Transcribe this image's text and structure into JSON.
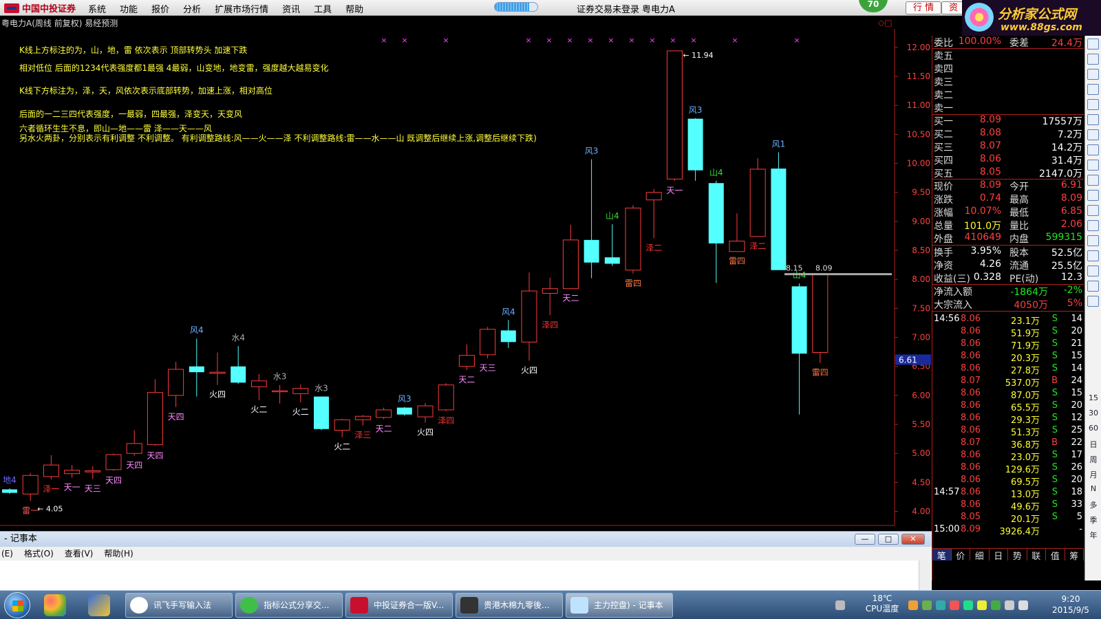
{
  "topbar": {
    "brand": "中国中投证券",
    "menu": [
      "系统",
      "功能",
      "报价",
      "分析",
      "扩展市场行情",
      "资讯",
      "工具",
      "帮助"
    ],
    "login_status": "证券交易未登录",
    "stock_name": "粤电力A",
    "badge": "70",
    "tab_quote": "行 情",
    "tab_trade": "资",
    "progress_fraction": 0.8,
    "logo_line1": "分析家公式网",
    "logo_line2": "www.88gs.com"
  },
  "chart": {
    "title": "粤电力A(周线 前复权) 易经预测",
    "notes": [
      "K线上方标注的为，山，地，雷 依次表示 顶部转势头  加速下跌",
      "相对低位 后面的1234代表强度都1最强 4最弱，山变地，地变雷，强度越大越易变化",
      "K线下方标注为，泽，天，风依次表示底部转势，加速上涨，相对高位",
      "后面的一二三四代表强度，一最弱，四最强，泽变天，天变风",
      "六者循环生生不息，即山—地——雷  泽——天——风",
      "另水火两卦，分别表示有利调整 不利调整。 有利调整路线:风——火——泽   不利调整路线:雷——水——山  既调整后继续上涨,调整后继续下跌)"
    ],
    "y_ticks": [
      "12.00",
      "11.50",
      "11.00",
      "10.50",
      "10.00",
      "9.50",
      "9.00",
      "8.50",
      "8.00",
      "7.50",
      "7.00",
      "6.50",
      "6.00",
      "5.50",
      "5.00",
      "4.50",
      "4.00"
    ],
    "current_price_tag": "6.61",
    "high_label": "11.94",
    "low_label": "4.05",
    "price_line_label": "8.15",
    "price_line_label2": "8.09"
  },
  "chart_data": {
    "type": "candlestick",
    "ylim": [
      3.9,
      12.2
    ],
    "candles": [
      {
        "o": 4.32,
        "c": 4.38,
        "h": 4.4,
        "l": 4.3,
        "up": false,
        "lab": "地4",
        "labc": "#6a6aff",
        "pos": "above"
      },
      {
        "o": 4.3,
        "c": 4.62,
        "h": 4.66,
        "l": 4.18,
        "up": true,
        "lab": "雷一",
        "labc": "#ff5555",
        "pos": "below"
      },
      {
        "o": 4.6,
        "c": 4.8,
        "h": 4.97,
        "l": 4.55,
        "up": true,
        "lab": "泽一",
        "labc": "#ff3333",
        "pos": "below"
      },
      {
        "o": 4.65,
        "c": 4.71,
        "h": 4.8,
        "l": 4.58,
        "up": true,
        "lab": "天一",
        "labc": "#ff88ff",
        "pos": "below"
      },
      {
        "o": 4.68,
        "c": 4.7,
        "h": 4.78,
        "l": 4.56,
        "up": true,
        "lab": "天三",
        "labc": "#ff88ff",
        "pos": "below"
      },
      {
        "o": 4.72,
        "c": 4.98,
        "h": 5.0,
        "l": 4.7,
        "up": true,
        "lab": "天四",
        "labc": "#ff88ff",
        "pos": "below"
      },
      {
        "o": 5.0,
        "c": 5.17,
        "h": 5.4,
        "l": 4.96,
        "up": true,
        "lab": "天四",
        "labc": "#ff88ff",
        "pos": "below"
      },
      {
        "o": 5.15,
        "c": 6.05,
        "h": 6.28,
        "l": 5.13,
        "up": true,
        "lab": "天四",
        "labc": "#ff88ff",
        "pos": "below"
      },
      {
        "o": 6.0,
        "c": 6.45,
        "h": 6.58,
        "l": 5.8,
        "up": true,
        "lab": "天四",
        "labc": "#ff88ff",
        "pos": "below"
      },
      {
        "o": 6.5,
        "c": 6.4,
        "h": 6.98,
        "l": 5.98,
        "up": false,
        "lab": "风4",
        "labc": "#6ab0ff",
        "pos": "above"
      },
      {
        "o": 6.38,
        "c": 6.4,
        "h": 6.74,
        "l": 6.18,
        "up": true,
        "lab": "火四",
        "labc": "#ffffff",
        "pos": "below"
      },
      {
        "o": 6.5,
        "c": 6.22,
        "h": 6.85,
        "l": 6.2,
        "up": false,
        "lab": "水4",
        "labc": "#aaaaaa",
        "pos": "above"
      },
      {
        "o": 6.15,
        "c": 6.25,
        "h": 6.37,
        "l": 5.92,
        "up": true,
        "lab": "火二",
        "labc": "#ffffff",
        "pos": "below"
      },
      {
        "o": 6.08,
        "c": 6.08,
        "h": 6.18,
        "l": 5.86,
        "up": true,
        "lab": "水3",
        "labc": "#aaaaaa",
        "pos": "above"
      },
      {
        "o": 6.03,
        "c": 6.12,
        "h": 6.19,
        "l": 5.88,
        "up": true,
        "lab": "火二",
        "labc": "#ffffff",
        "pos": "below"
      },
      {
        "o": 5.98,
        "c": 5.42,
        "h": 5.98,
        "l": 5.4,
        "up": false,
        "lab": "水3",
        "labc": "#aaaaaa",
        "pos": "above"
      },
      {
        "o": 5.4,
        "c": 5.58,
        "h": 5.6,
        "l": 5.28,
        "up": true,
        "lab": "火二",
        "labc": "#ffffff",
        "pos": "below"
      },
      {
        "o": 5.58,
        "c": 5.64,
        "h": 5.66,
        "l": 5.48,
        "up": true,
        "lab": "泽三",
        "labc": "#ff3333",
        "pos": "below"
      },
      {
        "o": 5.62,
        "c": 5.75,
        "h": 5.79,
        "l": 5.59,
        "up": true,
        "lab": "天二",
        "labc": "#ff88ff",
        "pos": "below"
      },
      {
        "o": 5.79,
        "c": 5.67,
        "h": 5.8,
        "l": 5.65,
        "up": false,
        "lab": "风3",
        "labc": "#6ab0ff",
        "pos": "above"
      },
      {
        "o": 5.63,
        "c": 5.82,
        "h": 5.87,
        "l": 5.53,
        "up": true,
        "lab": "火四",
        "labc": "#ffffff",
        "pos": "below"
      },
      {
        "o": 5.75,
        "c": 6.18,
        "h": 6.21,
        "l": 5.73,
        "up": true,
        "lab": "泽四",
        "labc": "#ff3333",
        "pos": "below"
      },
      {
        "o": 6.5,
        "c": 6.69,
        "h": 6.88,
        "l": 6.44,
        "up": true,
        "lab": "天二",
        "labc": "#ff88ff",
        "pos": "below"
      },
      {
        "o": 6.7,
        "c": 7.14,
        "h": 7.18,
        "l": 6.64,
        "up": true,
        "lab": "天三",
        "labc": "#ff88ff",
        "pos": "below"
      },
      {
        "o": 7.12,
        "c": 6.92,
        "h": 7.3,
        "l": 6.82,
        "up": false,
        "lab": "风4",
        "labc": "#6ab0ff",
        "pos": "above"
      },
      {
        "o": 6.92,
        "c": 7.8,
        "h": 8.12,
        "l": 6.6,
        "up": true,
        "lab": "火四",
        "labc": "#ffffff",
        "pos": "below"
      },
      {
        "o": 7.76,
        "c": 7.84,
        "h": 8.03,
        "l": 7.38,
        "up": true,
        "lab": "泽四",
        "labc": "#ff3333",
        "pos": "below"
      },
      {
        "o": 7.84,
        "c": 8.68,
        "h": 8.94,
        "l": 7.84,
        "up": true,
        "lab": "天二",
        "labc": "#ff88ff",
        "pos": "below"
      },
      {
        "o": 8.68,
        "c": 8.29,
        "h": 10.07,
        "l": 8.02,
        "up": false,
        "lab": "风3",
        "labc": "#6ab0ff",
        "pos": "above"
      },
      {
        "o": 8.38,
        "c": 8.27,
        "h": 8.95,
        "l": 8.23,
        "up": false,
        "lab": "山4",
        "labc": "#33dd33",
        "pos": "above"
      },
      {
        "o": 8.16,
        "c": 9.23,
        "h": 9.28,
        "l": 8.1,
        "up": true,
        "lab": "雷四",
        "labc": "#ff7744",
        "pos": "below"
      },
      {
        "o": 9.37,
        "c": 9.5,
        "h": 9.56,
        "l": 8.71,
        "up": true,
        "lab": "泽二",
        "labc": "#ff3333",
        "pos": "below"
      },
      {
        "o": 9.73,
        "c": 11.94,
        "h": 11.94,
        "l": 9.7,
        "up": true,
        "lab": "天一",
        "labc": "#ff88ff",
        "pos": "below"
      },
      {
        "o": 10.77,
        "c": 9.88,
        "h": 10.78,
        "l": 9.7,
        "up": false,
        "lab": "风3",
        "labc": "#6ab0ff",
        "pos": "above"
      },
      {
        "o": 9.66,
        "c": 8.62,
        "h": 9.7,
        "l": 7.94,
        "up": false,
        "lab": "山4",
        "labc": "#33dd33",
        "pos": "above"
      },
      {
        "o": 8.66,
        "c": 8.48,
        "h": 9.14,
        "l": 8.48,
        "up": true,
        "lab": "雷四",
        "labc": "#ff7744",
        "pos": "below"
      },
      {
        "o": 9.9,
        "c": 8.74,
        "h": 10.09,
        "l": 8.74,
        "up": true,
        "lab": "泽二",
        "labc": "#ff3333",
        "pos": "below"
      },
      {
        "o": 9.91,
        "c": 8.16,
        "h": 10.19,
        "l": 8.16,
        "up": false,
        "lab": "风1",
        "labc": "#6ab0ff",
        "pos": "above"
      },
      {
        "o": 7.88,
        "c": 6.72,
        "h": 7.93,
        "l": 5.67,
        "up": false,
        "lab": "山4",
        "labc": "#33dd33",
        "pos": "above"
      },
      {
        "o": 6.74,
        "c": 8.09,
        "h": 8.09,
        "l": 6.56,
        "up": true,
        "lab": "雷四",
        "labc": "#ff7744",
        "pos": "below"
      }
    ]
  },
  "panel": {
    "weibi": {
      "label": "委比",
      "value": "100.00%",
      "label2": "委差",
      "value2": "24.4万"
    },
    "sells": [
      "卖五",
      "卖四",
      "卖三",
      "卖二",
      "卖一"
    ],
    "buys": [
      {
        "label": "买一",
        "price": "8.09",
        "vol": "17557万"
      },
      {
        "label": "买二",
        "price": "8.08",
        "vol": "7.2万"
      },
      {
        "label": "买三",
        "price": "8.07",
        "vol": "14.2万"
      },
      {
        "label": "买四",
        "price": "8.06",
        "vol": "31.4万"
      },
      {
        "label": "买五",
        "price": "8.05",
        "vol": "2147.0万"
      }
    ],
    "quote": [
      {
        "l1": "现价",
        "v1": "8.09",
        "c1": "red",
        "l2": "今开",
        "v2": "6.91",
        "c2": "red"
      },
      {
        "l1": "涨跌",
        "v1": "0.74",
        "c1": "red",
        "l2": "最高",
        "v2": "8.09",
        "c2": "red"
      },
      {
        "l1": "涨幅",
        "v1": "10.07%",
        "c1": "red",
        "l2": "最低",
        "v2": "6.85",
        "c2": "red"
      },
      {
        "l1": "总量",
        "v1": "101.0万",
        "c1": "yellow",
        "l2": "量比",
        "v2": "2.06",
        "c2": "red"
      },
      {
        "l1": "外盘",
        "v1": "410649",
        "c1": "red",
        "l2": "内盘",
        "v2": "599315",
        "c2": "green"
      }
    ],
    "stats": [
      {
        "l1": "换手",
        "v1": "3.95%",
        "c1": "white",
        "l2": "股本",
        "v2": "52.5亿",
        "c2": "white"
      },
      {
        "l1": "净资",
        "v1": "4.26",
        "c1": "white",
        "l2": "流通",
        "v2": "25.5亿",
        "c2": "white"
      },
      {
        "l1": "收益(三)",
        "v1": "0.328",
        "c1": "white",
        "l2": "PE(动)",
        "v2": "12.3",
        "c2": "white"
      }
    ],
    "flows": [
      {
        "label": "净流入额",
        "v1": "-1864万",
        "c1": "green",
        "v2": "-2%",
        "c2": "green"
      },
      {
        "label": "大宗流入",
        "v1": "4050万",
        "c1": "red",
        "v2": "5%",
        "c2": "red"
      }
    ],
    "ticks": [
      {
        "time": "14:56",
        "price": "8.06",
        "vol": "23.1万",
        "side": "S",
        "n": "14"
      },
      {
        "time": "",
        "price": "8.06",
        "vol": "51.9万",
        "side": "S",
        "n": "20"
      },
      {
        "time": "",
        "price": "8.06",
        "vol": "71.9万",
        "side": "S",
        "n": "21"
      },
      {
        "time": "",
        "price": "8.06",
        "vol": "20.3万",
        "side": "S",
        "n": "15"
      },
      {
        "time": "",
        "price": "8.06",
        "vol": "27.8万",
        "side": "S",
        "n": "14"
      },
      {
        "time": "",
        "price": "8.07",
        "vol": "537.0万",
        "side": "B",
        "n": "24"
      },
      {
        "time": "",
        "price": "8.06",
        "vol": "87.0万",
        "side": "S",
        "n": "15"
      },
      {
        "time": "",
        "price": "8.06",
        "vol": "65.5万",
        "side": "S",
        "n": "20"
      },
      {
        "time": "",
        "price": "8.06",
        "vol": "29.3万",
        "side": "S",
        "n": "12"
      },
      {
        "time": "",
        "price": "8.06",
        "vol": "51.3万",
        "side": "S",
        "n": "25"
      },
      {
        "time": "",
        "price": "8.07",
        "vol": "36.8万",
        "side": "B",
        "n": "22"
      },
      {
        "time": "",
        "price": "8.06",
        "vol": "23.0万",
        "side": "S",
        "n": "17"
      },
      {
        "time": "",
        "price": "8.06",
        "vol": "129.6万",
        "side": "S",
        "n": "26"
      },
      {
        "time": "",
        "price": "8.06",
        "vol": "69.5万",
        "side": "S",
        "n": "20"
      },
      {
        "time": "14:57",
        "price": "8.06",
        "vol": "13.0万",
        "side": "S",
        "n": "18"
      },
      {
        "time": "",
        "price": "8.06",
        "vol": "49.6万",
        "side": "S",
        "n": "33"
      },
      {
        "time": "",
        "price": "8.05",
        "vol": "20.1万",
        "side": "S",
        "n": "5"
      },
      {
        "time": "15:00",
        "price": "8.09",
        "vol": "3926.4万",
        "side": "",
        "n": "-"
      }
    ],
    "tabs": [
      "笔",
      "价",
      "细",
      "日",
      "势",
      "联",
      "值",
      "筹"
    ]
  },
  "sidebar_icons": [
    "15",
    "30",
    "60",
    "日",
    "周",
    "月",
    "N",
    "多",
    "季",
    "年"
  ],
  "notepad": {
    "title": "- 记事本",
    "menu": [
      "(E)",
      "格式(O)",
      "查看(V)",
      "帮助(H)"
    ]
  },
  "taskbar": {
    "items": [
      "讯飞手写输入法",
      "指标公式分享交...",
      "中投证券合一版V...",
      "贵港木棉九零後...",
      "主力控盘) - 记事本"
    ],
    "temp": "18℃",
    "temp_label": "CPU温度",
    "time": "9:20",
    "date": "2015/9/5"
  }
}
